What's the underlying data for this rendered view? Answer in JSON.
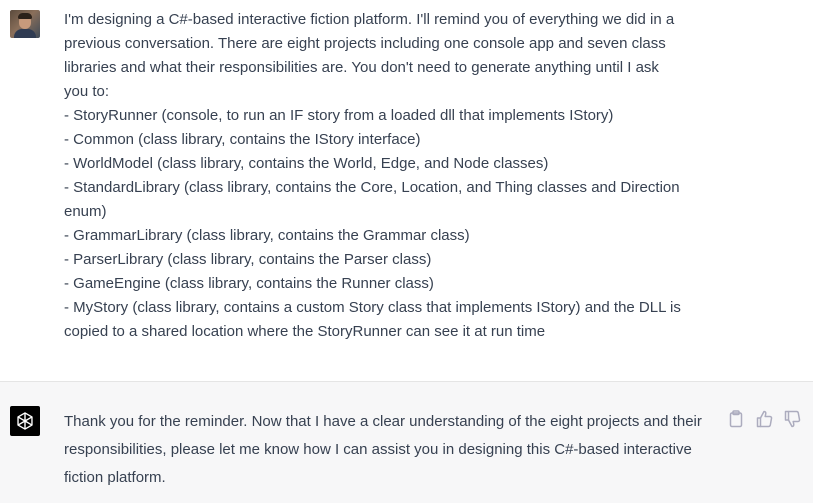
{
  "user_message": {
    "text": "I'm designing a C#-based interactive fiction platform. I'll remind you of everything we did in a\nprevious conversation. There are eight projects including one console app and seven class\nlibraries and what their responsibilities are. You don't need to generate anything until I ask\nyou to:\n- StoryRunner (console, to run an IF story from a loaded dll that implements IStory)\n- Common (class library, contains the IStory interface)\n- WorldModel (class library, contains the World, Edge, and Node classes)\n- StandardLibrary (class library, contains the Core, Location, and Thing classes and Direction\nenum)\n- GrammarLibrary (class library, contains the Grammar class)\n- ParserLibrary (class library, contains the Parser class)\n- GameEngine (class library, contains the Runner class)\n- MyStory (class library, contains a custom Story class that implements IStory) and the DLL is\ncopied to a shared location where the StoryRunner can see it at run time"
  },
  "assistant_message": {
    "text": "Thank you for the reminder. Now that I have a clear understanding of the eight projects and their responsibilities, please let me know how I can assist you in designing this C#-based interactive fiction platform."
  },
  "actions": {
    "icons": [
      "clipboard-icon",
      "thumbs-up-icon",
      "thumbs-down-icon"
    ]
  },
  "colors": {
    "text": "#374151",
    "assistant_bg": "#f7f7f8",
    "logo_bg": "#000000",
    "icon": "#acacbe"
  }
}
